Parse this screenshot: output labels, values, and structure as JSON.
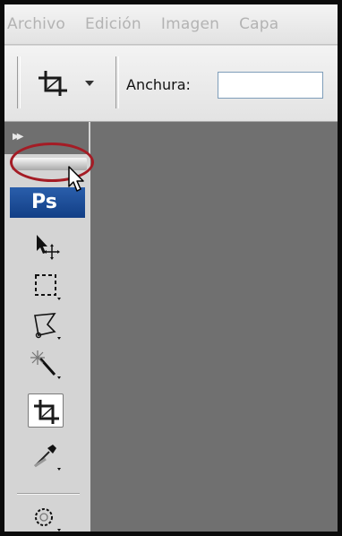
{
  "menu": {
    "items": [
      "Archivo",
      "Edición",
      "Imagen",
      "Capa"
    ]
  },
  "options_bar": {
    "tool_icon": "crop-icon",
    "width_label": "Anchura:",
    "width_value": ""
  },
  "tools_panel": {
    "logo_text": "Ps",
    "collapse_icon": "double-chevron-right-icon",
    "tools": [
      {
        "icon": "move-icon",
        "selected": false
      },
      {
        "icon": "marquee-icon",
        "selected": false
      },
      {
        "icon": "lasso-icon",
        "selected": false
      },
      {
        "icon": "magic-wand-icon",
        "selected": false
      },
      {
        "icon": "crop-icon",
        "selected": true
      },
      {
        "icon": "eyedropper-icon",
        "selected": false
      },
      {
        "icon": "healing-brush-icon",
        "selected": false
      }
    ]
  },
  "colors": {
    "canvas": "#707070",
    "panel": "#d4d4d4",
    "logo": "#1d4f9c",
    "highlight": "#a41c25"
  }
}
